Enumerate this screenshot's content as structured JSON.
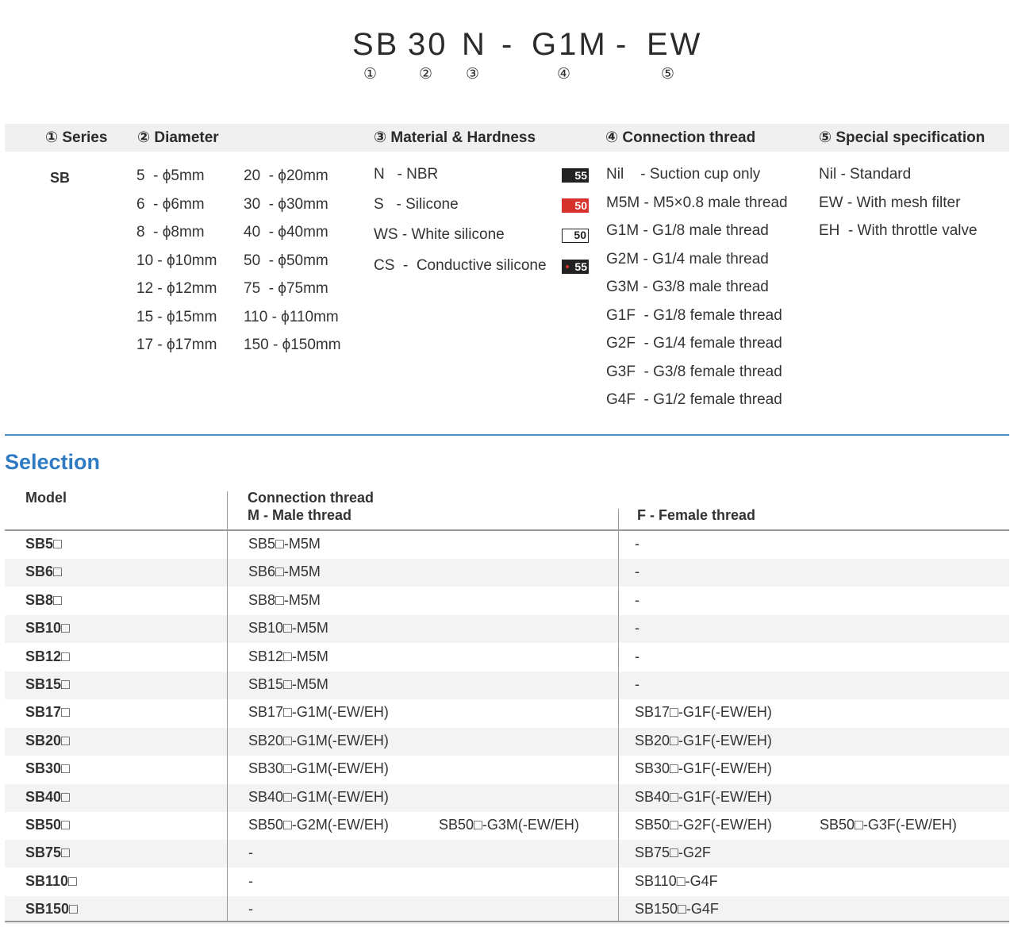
{
  "code": {
    "parts": [
      "SB",
      "30",
      "N",
      "-",
      "G1M",
      "-",
      "EW"
    ],
    "numbers": [
      "①",
      "②",
      "③",
      "④",
      "⑤"
    ]
  },
  "headers": {
    "series": "① Series",
    "diameter": "② Diameter",
    "material": "③ Material & Hardness",
    "connection": "④ Connection thread",
    "special": "⑤ Special specification"
  },
  "series": {
    "value": "SB"
  },
  "diameter": {
    "col1": [
      "5  - ϕ5mm",
      "6  - ϕ6mm",
      "8  - ϕ8mm",
      "10 - ϕ10mm",
      "12 - ϕ12mm",
      "15 - ϕ15mm",
      "17 - ϕ17mm"
    ],
    "col2": [
      "20  - ϕ20mm",
      "30  - ϕ30mm",
      "40  - ϕ40mm",
      "50  - ϕ50mm",
      "75  - ϕ75mm",
      "110 - ϕ110mm",
      "150 - ϕ150mm"
    ]
  },
  "material": {
    "items": [
      {
        "label": "N   - NBR",
        "hardness": "55",
        "style": "dark"
      },
      {
        "label": "S   - Silicone",
        "hardness": "50",
        "style": "red"
      },
      {
        "label": "WS - White silicone",
        "hardness": "50",
        "style": "white"
      },
      {
        "label": "CS  -  Conductive silicone",
        "hardness": "55",
        "style": "dark-dot"
      }
    ]
  },
  "connection": {
    "items": [
      "Nil    - Suction cup only",
      "M5M - M5×0.8 male thread",
      "G1M - G1/8 male thread",
      "G2M - G1/4 male thread",
      "G3M - G3/8 male thread",
      "G1F  - G1/8 female thread",
      "G2F  - G1/4 female thread",
      "G3F  - G3/8 female thread",
      "G4F  - G1/2 female thread"
    ]
  },
  "special": {
    "items": [
      "Nil - Standard",
      "EW - With mesh filter",
      "EH  - With throttle valve"
    ]
  },
  "selection": {
    "title": "Selection",
    "col_model": "Model",
    "col_connection": "Connection thread",
    "col_male": "M - Male thread",
    "col_female": "F - Female thread",
    "rows": [
      {
        "model": "SB5□",
        "m1": "SB5□-M5M",
        "m2": "",
        "f1": "-",
        "f2": ""
      },
      {
        "model": "SB6□",
        "m1": "SB6□-M5M",
        "m2": "",
        "f1": "-",
        "f2": ""
      },
      {
        "model": "SB8□",
        "m1": "SB8□-M5M",
        "m2": "",
        "f1": "-",
        "f2": ""
      },
      {
        "model": "SB10□",
        "m1": "SB10□-M5M",
        "m2": "",
        "f1": "-",
        "f2": ""
      },
      {
        "model": "SB12□",
        "m1": "SB12□-M5M",
        "m2": "",
        "f1": "-",
        "f2": ""
      },
      {
        "model": "SB15□",
        "m1": "SB15□-M5M",
        "m2": "",
        "f1": "-",
        "f2": ""
      },
      {
        "model": "SB17□",
        "m1": "SB17□-G1M(-EW/EH)",
        "m2": "",
        "f1": "SB17□-G1F(-EW/EH)",
        "f2": ""
      },
      {
        "model": "SB20□",
        "m1": "SB20□-G1M(-EW/EH)",
        "m2": "",
        "f1": "SB20□-G1F(-EW/EH)",
        "f2": ""
      },
      {
        "model": "SB30□",
        "m1": "SB30□-G1M(-EW/EH)",
        "m2": "",
        "f1": "SB30□-G1F(-EW/EH)",
        "f2": ""
      },
      {
        "model": "SB40□",
        "m1": "SB40□-G1M(-EW/EH)",
        "m2": "",
        "f1": "SB40□-G1F(-EW/EH)",
        "f2": ""
      },
      {
        "model": "SB50□",
        "m1": "SB50□-G2M(-EW/EH)",
        "m2": "SB50□-G3M(-EW/EH)",
        "f1": "SB50□-G2F(-EW/EH)",
        "f2": "SB50□-G3F(-EW/EH)"
      },
      {
        "model": "SB75□",
        "m1": "-",
        "m2": "",
        "f1": "SB75□-G2F",
        "f2": ""
      },
      {
        "model": "SB110□",
        "m1": "-",
        "m2": "",
        "f1": "SB110□-G4F",
        "f2": ""
      },
      {
        "model": "SB150□",
        "m1": "-",
        "m2": "",
        "f1": "SB150□-G4F",
        "f2": ""
      }
    ]
  }
}
